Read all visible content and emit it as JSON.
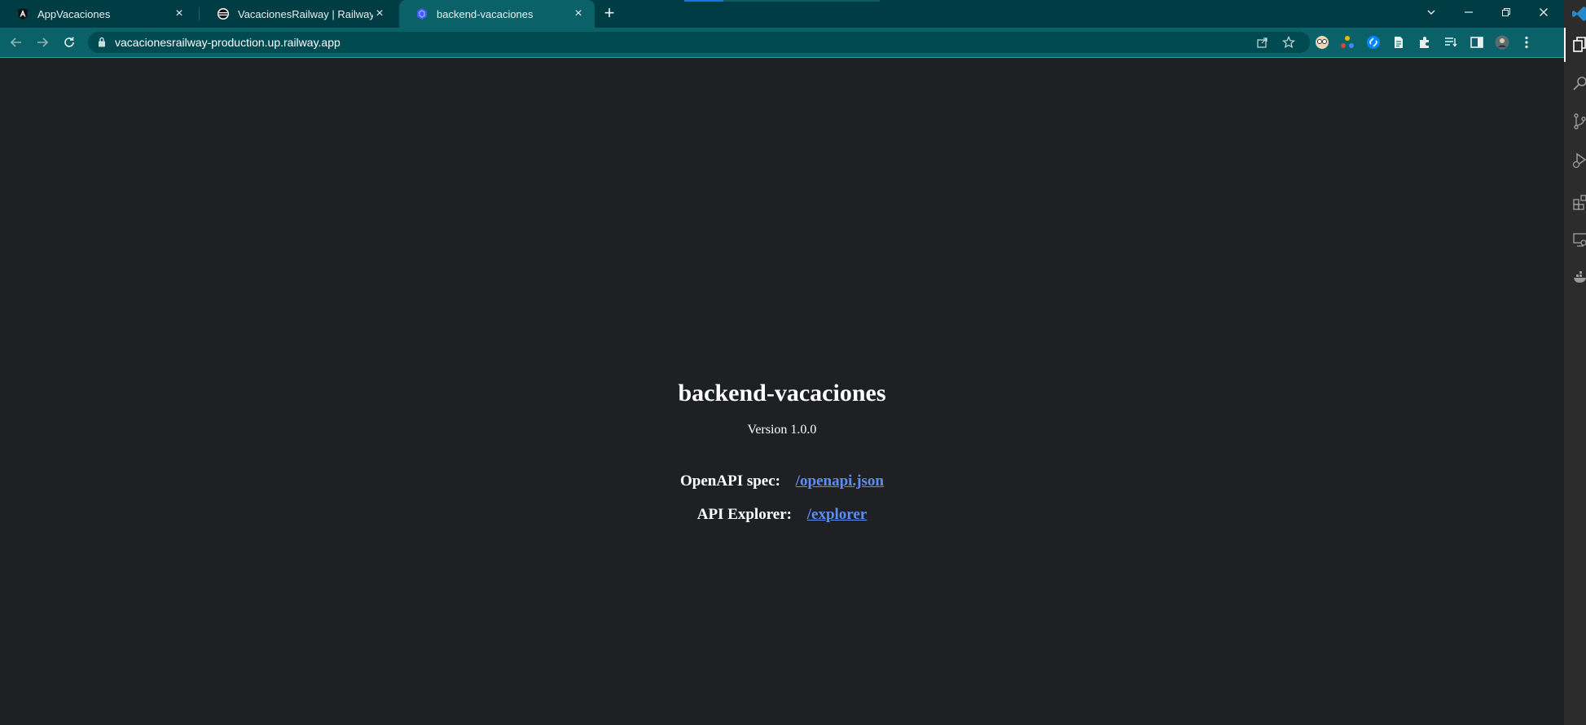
{
  "browser": {
    "tabs": [
      {
        "title": "AppVacaciones",
        "favicon": "angular-icon",
        "active": false
      },
      {
        "title": "VacacionesRailway | Railway",
        "favicon": "railway-icon",
        "active": false
      },
      {
        "title": "backend-vacaciones",
        "favicon": "loopback-icon",
        "active": true
      }
    ],
    "url": "vacacionesrailway-production.up.railway.app",
    "accent_color": "#0b6168",
    "tabstrip_color": "#003c43"
  },
  "page": {
    "heading": "backend-vacaciones",
    "version": "Version 1.0.0",
    "openapi_label": "OpenAPI spec:",
    "openapi_link": "/openapi.json",
    "explorer_label": "API Explorer:",
    "explorer_link": "/explorer",
    "link_color": "#5b8ff5",
    "background": "#1f2023"
  }
}
